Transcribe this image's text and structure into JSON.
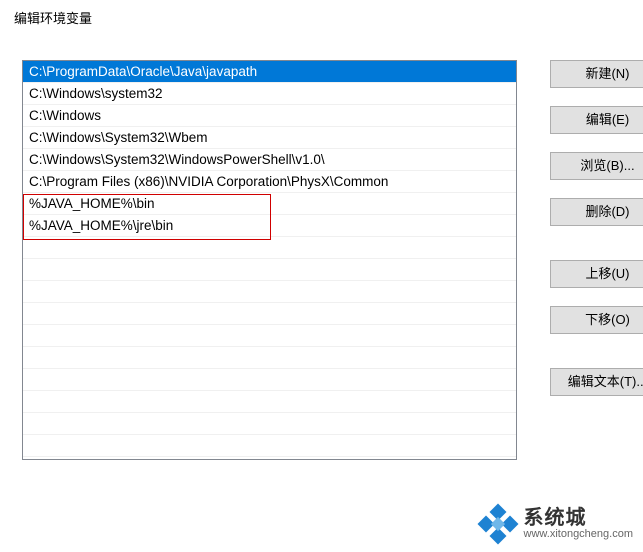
{
  "dialog": {
    "title": "编辑环境变量"
  },
  "paths": [
    {
      "value": "C:\\ProgramData\\Oracle\\Java\\javapath",
      "selected": true
    },
    {
      "value": "C:\\Windows\\system32",
      "selected": false
    },
    {
      "value": "C:\\Windows",
      "selected": false
    },
    {
      "value": "C:\\Windows\\System32\\Wbem",
      "selected": false
    },
    {
      "value": "C:\\Windows\\System32\\WindowsPowerShell\\v1.0\\",
      "selected": false
    },
    {
      "value": "C:\\Program Files (x86)\\NVIDIA Corporation\\PhysX\\Common",
      "selected": false
    },
    {
      "value": "%JAVA_HOME%\\bin",
      "selected": false
    },
    {
      "value": "%JAVA_HOME%\\jre\\bin",
      "selected": false
    }
  ],
  "buttons": {
    "new": "新建(N)",
    "edit": "编辑(E)",
    "browse": "浏览(B)...",
    "delete": "删除(D)",
    "moveUp": "上移(U)",
    "moveDown": "下移(O)",
    "editText": "编辑文本(T)..."
  },
  "watermark": {
    "brand": "系统城",
    "url": "www.xitongcheng.com"
  }
}
